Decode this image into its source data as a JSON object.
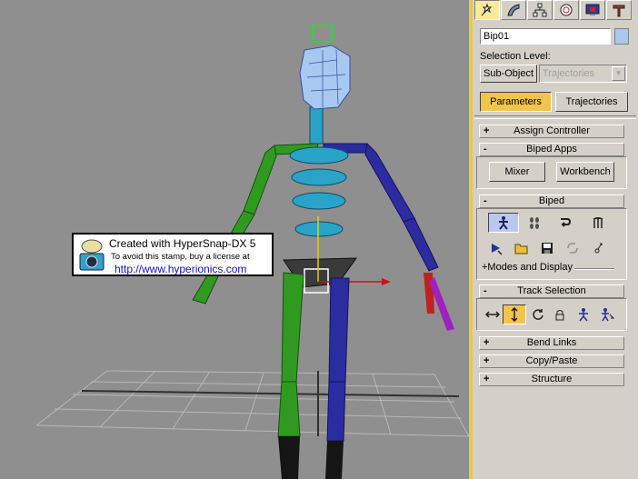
{
  "command_tabs": [
    {
      "icon": "create-icon",
      "active": true
    },
    {
      "icon": "modify-icon",
      "active": false
    },
    {
      "icon": "hierarchy-icon",
      "active": false
    },
    {
      "icon": "motion-icon",
      "active": false
    },
    {
      "icon": "display-icon",
      "active": false
    },
    {
      "icon": "utilities-icon",
      "active": false
    }
  ],
  "object_name": "Bip01",
  "selection_level_label": "Selection Level:",
  "sub_object_label": "Sub-Object",
  "sub_object_select": "Trajectories",
  "tabs": {
    "parameters": "Parameters",
    "trajectories": "Trajectories"
  },
  "rollouts": {
    "assign_controller": "Assign Controller",
    "biped_apps": "Biped Apps",
    "biped": "Biped",
    "track_selection": "Track Selection",
    "bend_links": "Bend Links",
    "copy_paste": "Copy/Paste",
    "structure": "Structure"
  },
  "biped_apps": {
    "mixer": "Mixer",
    "workbench": "Workbench"
  },
  "biped_buttons_row1": [
    "figure-mode-icon",
    "footstep-mode-icon",
    "motion-flow-icon",
    "mixer-mode-icon"
  ],
  "biped_buttons_row2": [
    "load-file-icon",
    "open-folder-icon",
    "save-file-icon",
    "convert-icon",
    "move-all-icon"
  ],
  "modes_and_display": "+Modes and Display",
  "track_selection_buttons": [
    "body-horizontal-icon",
    "body-vertical-icon",
    "body-rotation-icon",
    "lock-com-icon",
    "symmetrical-icon",
    "opposite-icon"
  ],
  "stamp": {
    "line1": "Created with HyperSnap-DX 5",
    "line2": "To avoid this stamp, buy a license at",
    "line3": "http://www.hyperionics.com"
  },
  "colors": {
    "accent": "#f3c44a",
    "viewport_bg": "#8f8f8f",
    "panel_bg": "#d4d0c8",
    "biped_cyan": "#29a3c7",
    "biped_green": "#2f9a1f",
    "biped_blue": "#2b2ca0"
  }
}
